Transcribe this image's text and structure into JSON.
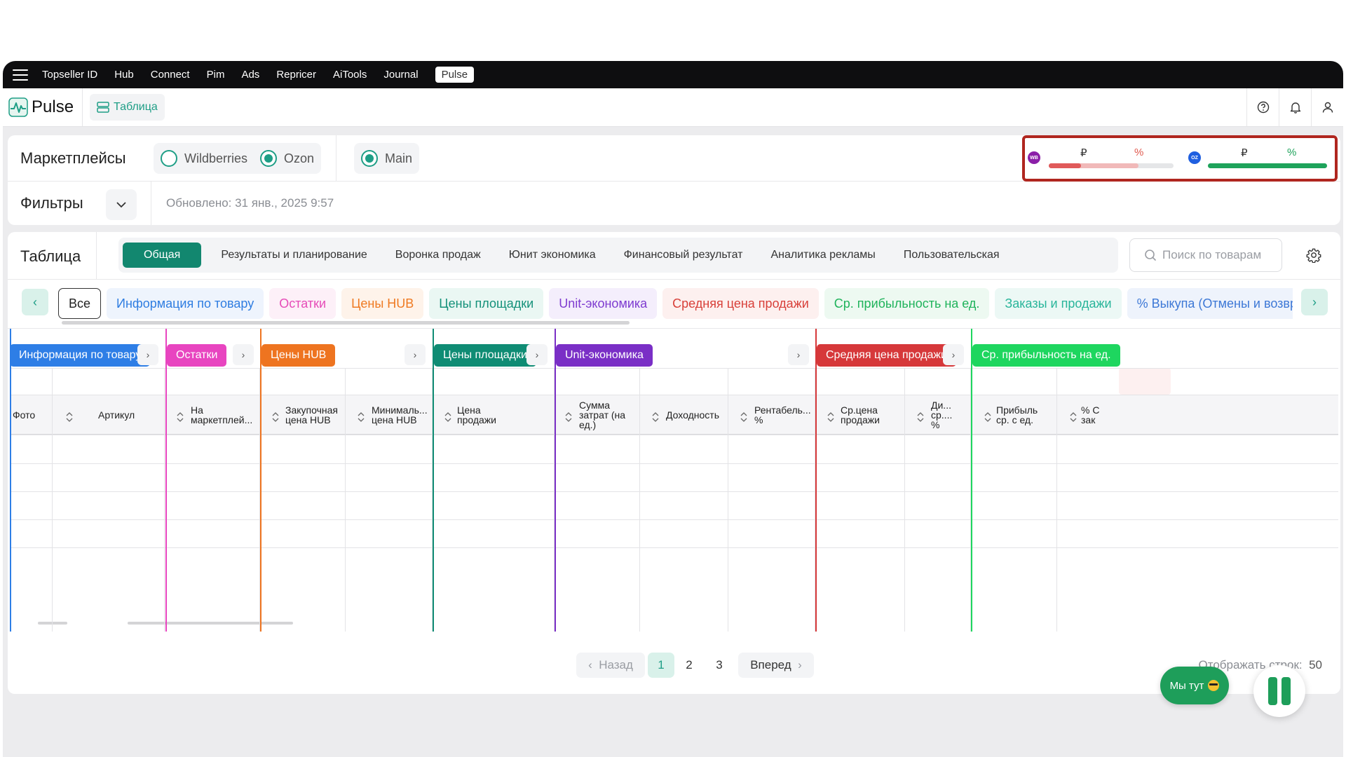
{
  "topnav": {
    "items": [
      "Topseller ID",
      "Hub",
      "Connect",
      "Pim",
      "Ads",
      "Repricer",
      "AiTools",
      "Journal",
      "Pulse"
    ],
    "active": "Pulse"
  },
  "header": {
    "app_name": "Pulse",
    "view_label": "Таблица"
  },
  "marketplaces": {
    "title": "Маркетплейсы",
    "options": [
      {
        "label": "Wildberries",
        "selected": false
      },
      {
        "label": "Ozon",
        "selected": true
      }
    ],
    "account": {
      "label": "Main",
      "selected": true
    }
  },
  "stats": {
    "wb": {
      "badge": "WB",
      "currency": "₽",
      "percent": "%",
      "bar_color": "#e05a5a",
      "bar_fill": 0.26,
      "bar_secondary": 0.72
    },
    "ozon": {
      "badge": "OZ",
      "currency": "₽",
      "percent": "%",
      "bar_color": "#1ea35b",
      "bar_fill": 1.0
    }
  },
  "filters": {
    "title": "Фильтры",
    "updated": "Обновлено: 31 янв., 2025 9:57"
  },
  "table": {
    "title": "Таблица",
    "tabs": [
      "Общая",
      "Результаты и планирование",
      "Воронка продаж",
      "Юнит экономика",
      "Финансовый результат",
      "Аналитика рекламы",
      "Пользовательская"
    ],
    "active_tab": "Общая",
    "search_placeholder": "Поиск по товарам",
    "chips": [
      {
        "label": "Все",
        "color": "#222222",
        "bg": "#ffffff"
      },
      {
        "label": "Информация по товару",
        "color": "#2f7de1",
        "bg": "#eef4fd"
      },
      {
        "label": "Остатки",
        "color": "#e64bb8",
        "bg": "#fdf0f8"
      },
      {
        "label": "Цены HUB",
        "color": "#ef7a22",
        "bg": "#fef3ea"
      },
      {
        "label": "Цены площадки",
        "color": "#14917a",
        "bg": "#eaf7f3"
      },
      {
        "label": "Unit-экономика",
        "color": "#7e3bd0",
        "bg": "#f4eefc"
      },
      {
        "label": "Средняя цена продажи",
        "color": "#d8403a",
        "bg": "#fdf0ef"
      },
      {
        "label": "Ср. прибыльность на ед.",
        "color": "#1fb35b",
        "bg": "#edf9f1"
      },
      {
        "label": "Заказы и продажи",
        "color": "#28b59a",
        "bg": "#ecf8f5"
      },
      {
        "label": "% Выкупа (Отмены и возвраты)",
        "color": "#3d78d6",
        "bg": "#eef3fc"
      }
    ],
    "groups": [
      {
        "label": "Информация по товару",
        "color": "#2e7ee6"
      },
      {
        "label": "Остатки",
        "color": "#e845c0"
      },
      {
        "label": "Цены HUB",
        "color": "#ee7420"
      },
      {
        "label": "Цены площадки",
        "color": "#0f8c74"
      },
      {
        "label": "Unit-экономика",
        "color": "#7a2fc6"
      },
      {
        "label": "Средняя цена продажи",
        "color": "#d6383a"
      },
      {
        "label": "Ср. прибыльность на ед.",
        "color": "#1ed65f"
      }
    ],
    "columns": [
      [
        "Фото"
      ],
      [
        "Артикул"
      ],
      [
        "На",
        "маркетплей..."
      ],
      [
        "Закупочная",
        "цена HUB"
      ],
      [
        "Минималь...",
        "цена HUB"
      ],
      [
        "Цена",
        "продажи"
      ],
      [
        "Сумма",
        "затрат (на",
        "ед.)"
      ],
      [
        "Доходность"
      ],
      [
        "Рентабель...",
        "%"
      ],
      [
        "Ср.цена",
        "продажи"
      ],
      [
        "Ди...",
        "ср....",
        "%"
      ],
      [
        "Прибыль",
        "ср. с ед."
      ],
      [
        "% С",
        "зак"
      ]
    ]
  },
  "pagination": {
    "prev": "Назад",
    "next": "Вперед",
    "pages": [
      "1",
      "2",
      "3"
    ],
    "current": "1",
    "rows_label": "Отображать строк:",
    "rows_value": "50"
  },
  "chat": {
    "label": "Мы тут"
  }
}
